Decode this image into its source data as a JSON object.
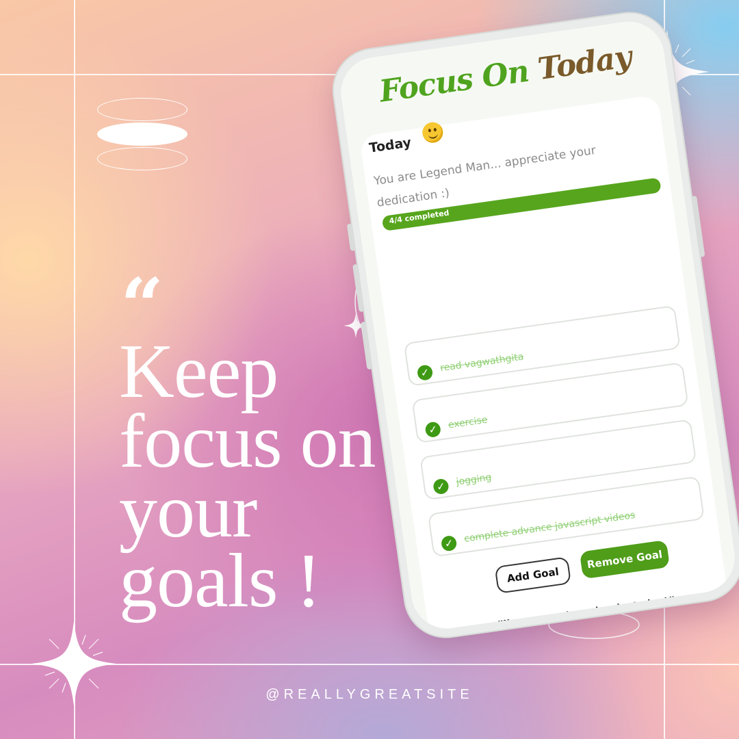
{
  "poster": {
    "quote_mark": "“",
    "headline_lines": [
      "Keep",
      "focus on",
      "your",
      "goals !"
    ],
    "handle": "@REALLYGREATSITE"
  },
  "app": {
    "title": {
      "focus": "Focus",
      "on": "On",
      "today": "Today"
    },
    "section_label": "Today",
    "message": "You are Legend Man... appreciate your dedication :)",
    "progress": {
      "label": "4/4 completed",
      "completed": 4,
      "total": 4
    },
    "goals": [
      {
        "text": "read vagwathgita",
        "done": true
      },
      {
        "text": "exercise",
        "done": true
      },
      {
        "text": "jogging",
        "done": true
      },
      {
        "text": "complete advance javascript videos",
        "done": true
      }
    ],
    "buttons": {
      "add": "Add Goal",
      "remove": "Remove Goal"
    },
    "footer_quote": "\"Move one step ahead, today!\""
  },
  "colors": {
    "brand_green": "#4fa31e",
    "brand_brown": "#7a5a2b",
    "accent_blue": "#86cdf0",
    "accent_pink": "#cf76b4"
  },
  "icons": [
    "smiley-icon",
    "check-icon",
    "sparkle-icon"
  ]
}
